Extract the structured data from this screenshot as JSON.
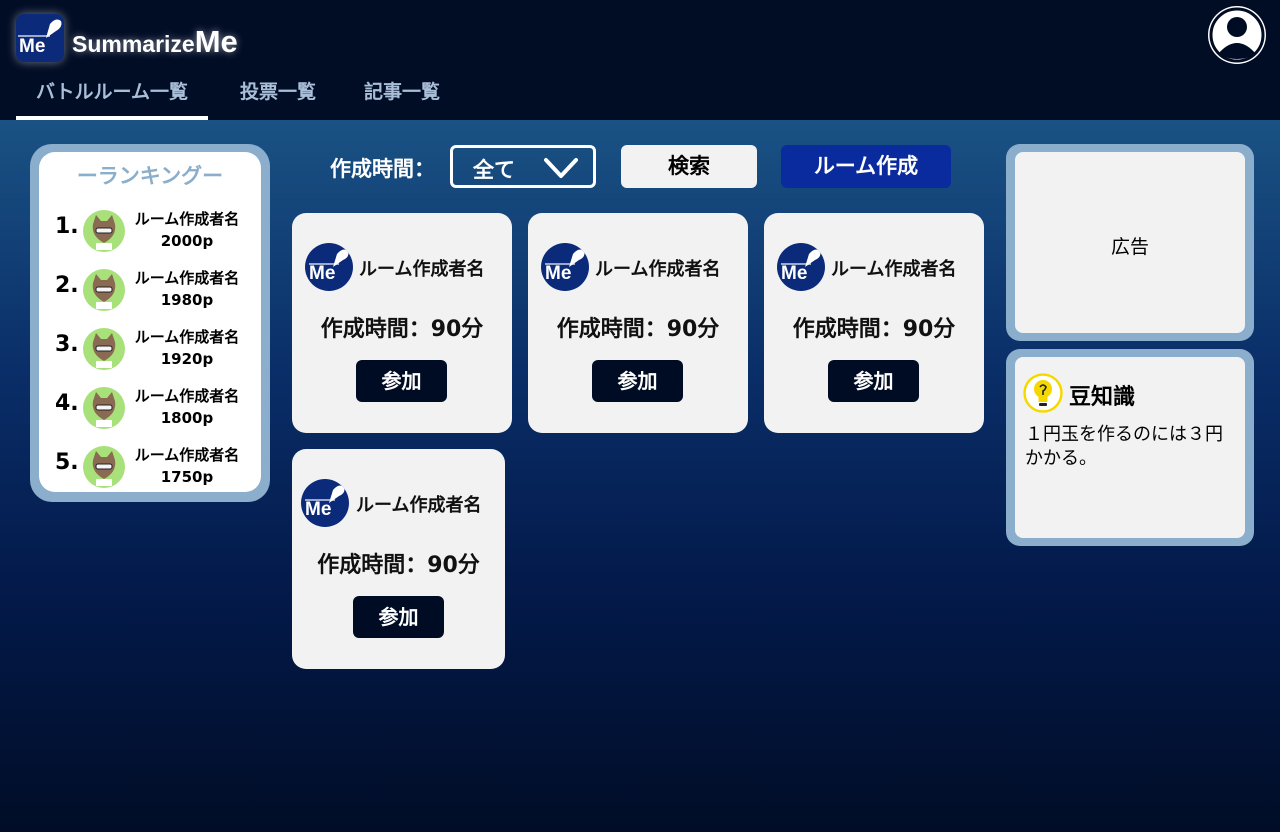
{
  "app": {
    "brand_prefix": "Summarize",
    "brand_suffix": "Me",
    "logo_text": "Me"
  },
  "nav": {
    "tabs": [
      {
        "label": "バトルルーム一覧"
      },
      {
        "label": "投票一覧"
      },
      {
        "label": "記事一覧"
      }
    ]
  },
  "ranking": {
    "title": "ーランキングー",
    "entries": [
      {
        "rank": "1.",
        "name": "ルーム作成者名",
        "points": "2000p"
      },
      {
        "rank": "2.",
        "name": "ルーム作成者名",
        "points": "1980p"
      },
      {
        "rank": "3.",
        "name": "ルーム作成者名",
        "points": "1920p"
      },
      {
        "rank": "4.",
        "name": "ルーム作成者名",
        "points": "1800p"
      },
      {
        "rank": "5.",
        "name": "ルーム作成者名",
        "points": "1750p"
      }
    ]
  },
  "filters": {
    "time_label": "作成時間：",
    "time_value": "全て",
    "search_label": "検索",
    "create_label": "ルーム作成"
  },
  "rooms": [
    {
      "logo_text": "Me",
      "creator": "ルーム作成者名",
      "time": "作成時間：90分",
      "join_label": "参加"
    },
    {
      "logo_text": "Me",
      "creator": "ルーム作成者名",
      "time": "作成時間：90分",
      "join_label": "参加"
    },
    {
      "logo_text": "Me",
      "creator": "ルーム作成者名",
      "time": "作成時間：90分",
      "join_label": "参加"
    },
    {
      "logo_text": "Me",
      "creator": "ルーム作成者名",
      "time": "作成時間：90分",
      "join_label": "参加"
    }
  ],
  "ad": {
    "label": "広告"
  },
  "tip": {
    "title": "豆知識",
    "body": "１円玉を作るのには３円かかる。"
  },
  "colors": {
    "accent": "#0a2b9e",
    "frame": "#8aaecb",
    "header_bg": "#010c25",
    "tab_text": "#a9bfd9"
  }
}
